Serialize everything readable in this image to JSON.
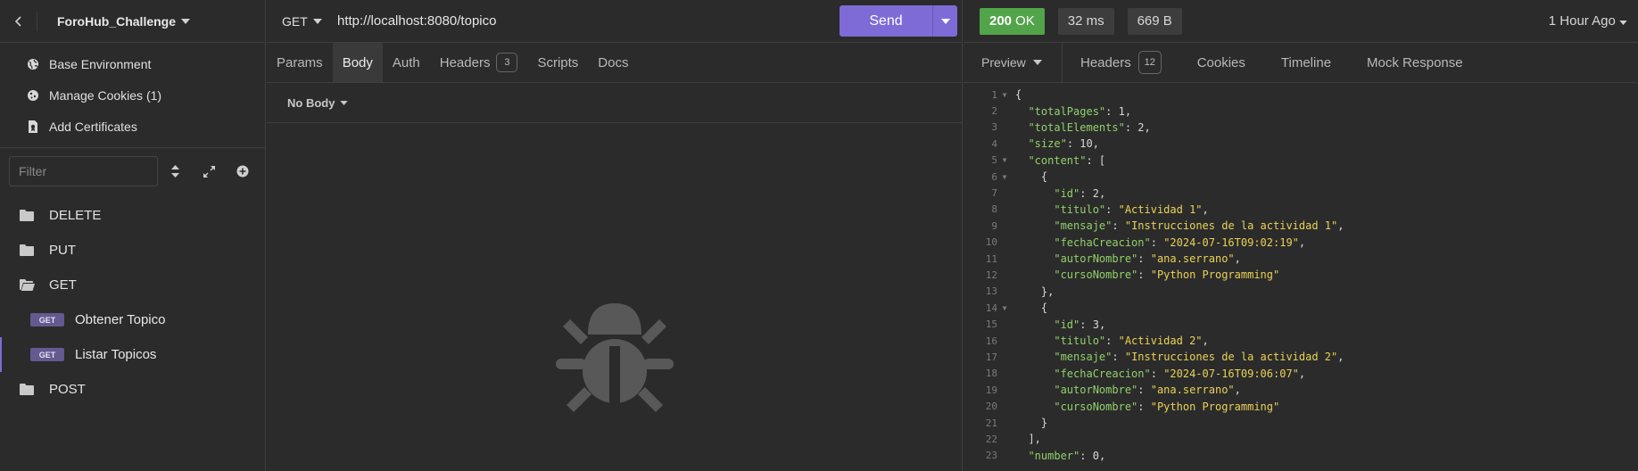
{
  "sidebar": {
    "project_name": "ForoHub_Challenge",
    "env_items": [
      {
        "label": "Base Environment",
        "icon": "globe-icon"
      },
      {
        "label": "Manage Cookies (1)",
        "icon": "cookie-icon"
      },
      {
        "label": "Add Certificates",
        "icon": "certificate-icon"
      }
    ],
    "filter_placeholder": "Filter",
    "folders": {
      "delete": "DELETE",
      "put": "PUT",
      "get": "GET",
      "post": "POST"
    },
    "requests": [
      {
        "method": "GET",
        "label": "Obtener Topico"
      },
      {
        "method": "GET",
        "label": "Listar Topicos"
      }
    ]
  },
  "request": {
    "method": "GET",
    "url": "http://localhost:8080/topico",
    "send_label": "Send",
    "tabs": {
      "params": "Params",
      "body": "Body",
      "auth": "Auth",
      "headers": "Headers",
      "headers_count": "3",
      "scripts": "Scripts",
      "docs": "Docs"
    },
    "body_mode": "No Body"
  },
  "response": {
    "status_code": "200",
    "status_text": "OK",
    "time": "32 ms",
    "size": "669 B",
    "time_ago": "1 Hour Ago",
    "tabs": {
      "preview": "Preview",
      "headers": "Headers",
      "headers_count": "12",
      "cookies": "Cookies",
      "timeline": "Timeline",
      "mock": "Mock Response"
    },
    "lines": [
      {
        "n": "1",
        "fold": true,
        "segs": [
          [
            "p",
            "{"
          ]
        ]
      },
      {
        "n": "2",
        "fold": false,
        "segs": [
          [
            "p",
            "  "
          ],
          [
            "k",
            "\"totalPages\""
          ],
          [
            "p",
            ": "
          ],
          [
            "n",
            "1"
          ],
          [
            "p",
            ","
          ]
        ]
      },
      {
        "n": "3",
        "fold": false,
        "segs": [
          [
            "p",
            "  "
          ],
          [
            "k",
            "\"totalElements\""
          ],
          [
            "p",
            ": "
          ],
          [
            "n",
            "2"
          ],
          [
            "p",
            ","
          ]
        ]
      },
      {
        "n": "4",
        "fold": false,
        "segs": [
          [
            "p",
            "  "
          ],
          [
            "k",
            "\"size\""
          ],
          [
            "p",
            ": "
          ],
          [
            "n",
            "10"
          ],
          [
            "p",
            ","
          ]
        ]
      },
      {
        "n": "5",
        "fold": true,
        "segs": [
          [
            "p",
            "  "
          ],
          [
            "k",
            "\"content\""
          ],
          [
            "p",
            ": ["
          ]
        ]
      },
      {
        "n": "6",
        "fold": true,
        "segs": [
          [
            "p",
            "    {"
          ]
        ]
      },
      {
        "n": "7",
        "fold": false,
        "segs": [
          [
            "p",
            "      "
          ],
          [
            "k",
            "\"id\""
          ],
          [
            "p",
            ": "
          ],
          [
            "n",
            "2"
          ],
          [
            "p",
            ","
          ]
        ]
      },
      {
        "n": "8",
        "fold": false,
        "segs": [
          [
            "p",
            "      "
          ],
          [
            "k",
            "\"titulo\""
          ],
          [
            "p",
            ": "
          ],
          [
            "s",
            "\"Actividad 1\""
          ],
          [
            "p",
            ","
          ]
        ]
      },
      {
        "n": "9",
        "fold": false,
        "segs": [
          [
            "p",
            "      "
          ],
          [
            "k",
            "\"mensaje\""
          ],
          [
            "p",
            ": "
          ],
          [
            "s",
            "\"Instrucciones de la actividad 1\""
          ],
          [
            "p",
            ","
          ]
        ]
      },
      {
        "n": "10",
        "fold": false,
        "segs": [
          [
            "p",
            "      "
          ],
          [
            "k",
            "\"fechaCreacion\""
          ],
          [
            "p",
            ": "
          ],
          [
            "s",
            "\"2024-07-16T09:02:19\""
          ],
          [
            "p",
            ","
          ]
        ]
      },
      {
        "n": "11",
        "fold": false,
        "segs": [
          [
            "p",
            "      "
          ],
          [
            "k",
            "\"autorNombre\""
          ],
          [
            "p",
            ": "
          ],
          [
            "s",
            "\"ana.serrano\""
          ],
          [
            "p",
            ","
          ]
        ]
      },
      {
        "n": "12",
        "fold": false,
        "segs": [
          [
            "p",
            "      "
          ],
          [
            "k",
            "\"cursoNombre\""
          ],
          [
            "p",
            ": "
          ],
          [
            "s",
            "\"Python Programming\""
          ]
        ]
      },
      {
        "n": "13",
        "fold": false,
        "segs": [
          [
            "p",
            "    },"
          ]
        ]
      },
      {
        "n": "14",
        "fold": true,
        "segs": [
          [
            "p",
            "    {"
          ]
        ]
      },
      {
        "n": "15",
        "fold": false,
        "segs": [
          [
            "p",
            "      "
          ],
          [
            "k",
            "\"id\""
          ],
          [
            "p",
            ": "
          ],
          [
            "n",
            "3"
          ],
          [
            "p",
            ","
          ]
        ]
      },
      {
        "n": "16",
        "fold": false,
        "segs": [
          [
            "p",
            "      "
          ],
          [
            "k",
            "\"titulo\""
          ],
          [
            "p",
            ": "
          ],
          [
            "s",
            "\"Actividad 2\""
          ],
          [
            "p",
            ","
          ]
        ]
      },
      {
        "n": "17",
        "fold": false,
        "segs": [
          [
            "p",
            "      "
          ],
          [
            "k",
            "\"mensaje\""
          ],
          [
            "p",
            ": "
          ],
          [
            "s",
            "\"Instrucciones de la actividad 2\""
          ],
          [
            "p",
            ","
          ]
        ]
      },
      {
        "n": "18",
        "fold": false,
        "segs": [
          [
            "p",
            "      "
          ],
          [
            "k",
            "\"fechaCreacion\""
          ],
          [
            "p",
            ": "
          ],
          [
            "s",
            "\"2024-07-16T09:06:07\""
          ],
          [
            "p",
            ","
          ]
        ]
      },
      {
        "n": "19",
        "fold": false,
        "segs": [
          [
            "p",
            "      "
          ],
          [
            "k",
            "\"autorNombre\""
          ],
          [
            "p",
            ": "
          ],
          [
            "s",
            "\"ana.serrano\""
          ],
          [
            "p",
            ","
          ]
        ]
      },
      {
        "n": "20",
        "fold": false,
        "segs": [
          [
            "p",
            "      "
          ],
          [
            "k",
            "\"cursoNombre\""
          ],
          [
            "p",
            ": "
          ],
          [
            "s",
            "\"Python Programming\""
          ]
        ]
      },
      {
        "n": "21",
        "fold": false,
        "segs": [
          [
            "p",
            "    }"
          ]
        ]
      },
      {
        "n": "22",
        "fold": false,
        "segs": [
          [
            "p",
            "  ],"
          ]
        ]
      },
      {
        "n": "23",
        "fold": false,
        "segs": [
          [
            "p",
            "  "
          ],
          [
            "k",
            "\"number\""
          ],
          [
            "p",
            ": "
          ],
          [
            "n",
            "0"
          ],
          [
            "p",
            ","
          ]
        ]
      }
    ]
  }
}
